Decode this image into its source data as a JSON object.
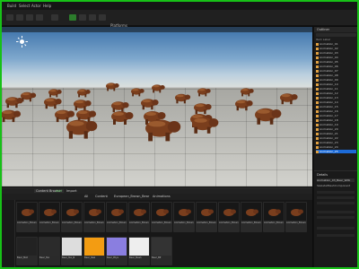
{
  "menubar": {
    "items": [
      "Build",
      "Select",
      "Actor",
      "Help"
    ]
  },
  "toolbar": {
    "platforms_label": "Platforms"
  },
  "viewport": {
    "sky_top_color": "#3b71a9",
    "horizon_color": "#d8dddd",
    "floor_color": "#a7a7a2"
  },
  "outliner": {
    "title": "Outliner",
    "column_label": "Item Label",
    "rows": [
      "Animation_01",
      "Animation_02",
      "Animation_03",
      "Animation_04",
      "Animation_05",
      "Animation_06",
      "Animation_07",
      "Animation_08",
      "Animation_09",
      "Animation_10",
      "Animation_11",
      "Animation_12",
      "Animation_13",
      "Animation_14",
      "Animation_15",
      "Animation_16",
      "Animation_17",
      "Animation_18",
      "Animation_19",
      "Animation_20",
      "Animation_21",
      "Animation_22",
      "Animation_23",
      "Animation_24",
      "Animation_25"
    ],
    "selected_index": 24
  },
  "details": {
    "title": "Details",
    "selected_actor": "Animation_03_Bear_Wdk",
    "component": "SkeletalMeshComponent"
  },
  "content_browser": {
    "tabs": [
      "Content Browser",
      "Add",
      "Import"
    ],
    "path": [
      "All",
      "Content",
      "European_Brown_Bear",
      "Animations"
    ],
    "assets": [
      "Animation_Brown_Bear_Idle",
      "Animation_Brown_Bear_Walk",
      "Animation_Brown_Bear_Run",
      "Animation_Brown_Bear_Sit",
      "Animation_Brown_Bear_Sleep",
      "Animation_Brown_Bear_Eat",
      "Animation_Brown_Bear_Attack",
      "Animation_Brown_Bear_Roar",
      "Animation_Brown_Bear_Swim",
      "Animation_Brown_Bear_Die",
      "Animation_Brown_Bear_Jump",
      "Animation_Brown_Bear_Turn",
      "Animation_Brown_Bear_Hit"
    ],
    "bottom_assets": [
      "Bear_Mat",
      "Bear_Tex",
      "Bear_Tex_N",
      "Bear_Skel",
      "Bear_Phys",
      "Bear_Mesh",
      "Bear_BP"
    ]
  },
  "colors": {
    "accent": "#1c6bd8",
    "bear": "#7a3e1d",
    "frame": "#17c017"
  }
}
